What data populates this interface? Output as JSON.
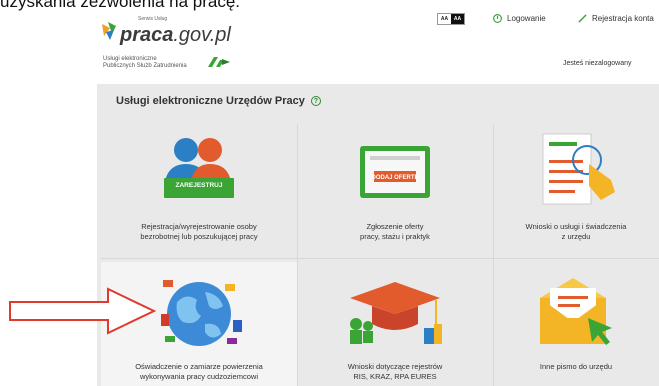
{
  "caption": "uzyskania zezwolenia na pracę.",
  "header": {
    "brand": "praca",
    "brand_suffix": ".gov.pl",
    "brand_small": "Serwis Usług",
    "subbrand_line1": "Usługi elektroniczne",
    "subbrand_line2": "Publicznych Służb Zatrudnienia",
    "contrast_light": "AA",
    "contrast_dark": "AA",
    "login": "Logowanie",
    "register": "Rejestracja konta",
    "status": "Jesteś niezalogowany"
  },
  "panel": {
    "title": "Usługi elektroniczne Urzędów Pracy"
  },
  "tiles": [
    {
      "line1": "Rejestracja/wyrejestrowanie osoby",
      "line2": "bezrobotnej lub poszukującej pracy",
      "badge": "ZAREJESTRUJ"
    },
    {
      "line1": "Zgłoszenie oferty",
      "line2": "pracy, stażu i praktyk",
      "badge": "DODAJ OFERTĘ"
    },
    {
      "line1": "Wnioski o usługi i świadczenia",
      "line2": "z urzędu"
    },
    {
      "line1": "Oświadczenie o zamiarze powierzenia",
      "line2": "wykonywania pracy cudzoziemcowi"
    },
    {
      "line1": "Wnioski dotyczące rejestrów",
      "line2": "RIS, KRAZ, RPA EURES"
    },
    {
      "line1": "Inne pismo do urzędu",
      "line2": ""
    }
  ],
  "colors": {
    "accent_green": "#3aa535",
    "accent_red": "#d9532b",
    "panel_bg": "#e9e9e9",
    "arrow": "#e03a2f"
  },
  "icons": {
    "help": "question-circle-icon",
    "login": "power-icon",
    "register": "pencil-icon"
  }
}
